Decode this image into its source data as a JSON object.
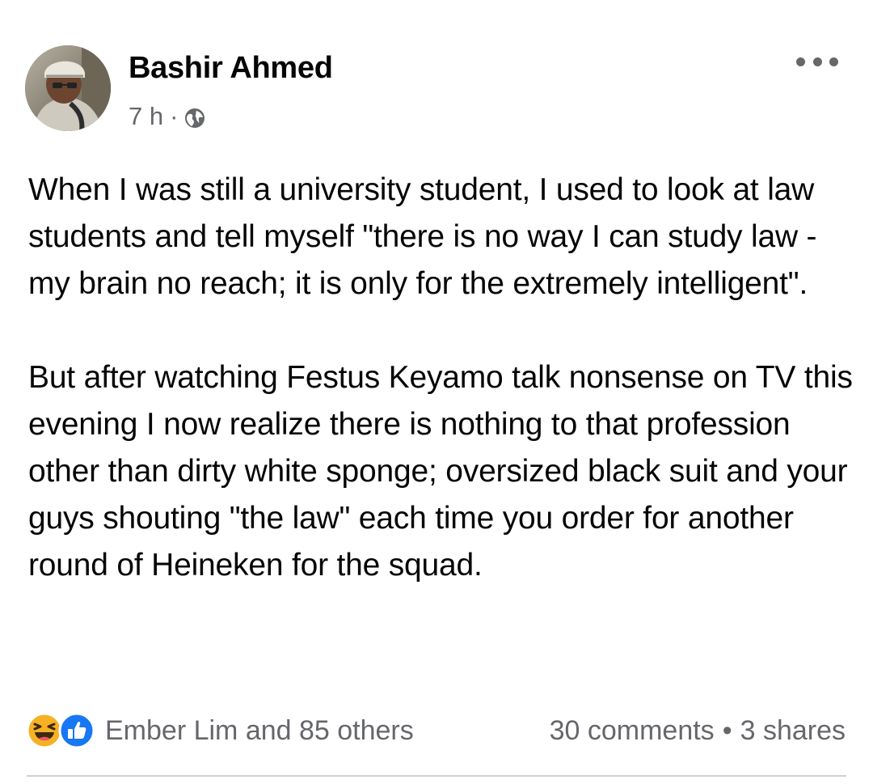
{
  "post": {
    "author": "Bashir Ahmed",
    "time": "7 h",
    "separator": "·",
    "privacy_icon": "globe-icon",
    "more_icon": "more-horizontal-icon",
    "paragraphs": [
      "When I was still a university student, I used to look at law students and tell myself \"there is no way I can study law - my brain no reach; it is only for the extremely intelligent\".",
      "But after watching Festus Keyamo talk nonsense on TV this evening I now realize there is nothing to that profession other than dirty white sponge; oversized black suit and your guys shouting \"the law\" each time you order for another round of Heineken for the squad."
    ],
    "reactions": {
      "icons": [
        "haha-reaction-icon",
        "like-reaction-icon"
      ],
      "text": "Ember Lim and 85 others"
    },
    "stats": {
      "comments": "30 comments",
      "bullet": "•",
      "shares": "3 shares"
    },
    "colors": {
      "text": "#050505",
      "secondary": "#65676b",
      "like_blue": "#1877f2",
      "haha_yellow": "#f7b125",
      "divider": "#ced0d4"
    }
  }
}
